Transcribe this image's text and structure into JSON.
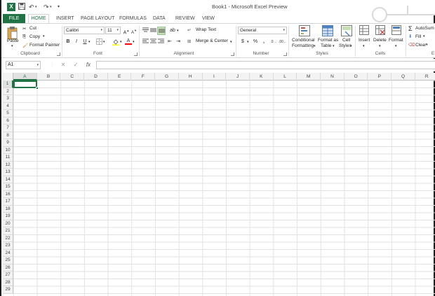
{
  "app": {
    "title": "Book1 - Microsoft Excel Preview",
    "icon_letter": "X"
  },
  "qat": {
    "save_icon": "save-icon",
    "undo_icon": "undo-icon",
    "redo_icon": "redo-icon",
    "customize_icon": "chevron-down-icon"
  },
  "tabs": [
    {
      "label": "FILE"
    },
    {
      "label": "HOME"
    },
    {
      "label": "INSERT"
    },
    {
      "label": "PAGE LAYOUT"
    },
    {
      "label": "FORMULAS"
    },
    {
      "label": "DATA"
    },
    {
      "label": "REVIEW"
    },
    {
      "label": "VIEW"
    }
  ],
  "ribbon": {
    "clipboard": {
      "label": "Clipboard",
      "paste": "Paste",
      "cut": "Cut",
      "copy": "Copy",
      "format_painter": "Format Painter"
    },
    "font": {
      "label": "Font",
      "family": "Calibri",
      "size": "11",
      "bold": "B",
      "italic": "I",
      "underline": "U"
    },
    "alignment": {
      "label": "Alignment",
      "wrap_text": "Wrap Text",
      "merge_center": "Merge & Center"
    },
    "number": {
      "label": "Number",
      "format": "General",
      "currency": "$",
      "percent": "%",
      "comma": ","
    },
    "styles": {
      "label": "Styles",
      "conditional_line1": "Conditional",
      "conditional_line2": "Formatting",
      "format_table_line1": "Format as",
      "format_table_line2": "Table",
      "cell_styles_line1": "Cell",
      "cell_styles_line2": "Styles"
    },
    "cells": {
      "label": "Cells",
      "insert": "Insert",
      "delete": "Delete",
      "format": "Format"
    },
    "editing": {
      "label": "E",
      "autosum": "AutoSum",
      "fill": "Fill",
      "clear": "Clear"
    }
  },
  "formula_bar": {
    "name_box": "A1",
    "cancel": "✕",
    "enter": "✓",
    "fx": "fx",
    "value": ""
  },
  "grid": {
    "columns": [
      "A",
      "B",
      "C",
      "D",
      "E",
      "F",
      "G",
      "H",
      "I",
      "J",
      "K",
      "L",
      "M",
      "N",
      "O",
      "P",
      "Q",
      "R"
    ],
    "rows": [
      "1",
      "2",
      "3",
      "4",
      "5",
      "6",
      "7",
      "8",
      "9",
      "10",
      "11",
      "12",
      "13",
      "14",
      "15",
      "16",
      "17",
      "18",
      "19",
      "20",
      "21",
      "22",
      "23",
      "24",
      "25",
      "26",
      "27",
      "28",
      "29"
    ],
    "active_cell": "A1"
  },
  "colors": {
    "accent": "#217346",
    "header_bg": "#f3f3f3",
    "gridline": "#e2e2e2"
  }
}
